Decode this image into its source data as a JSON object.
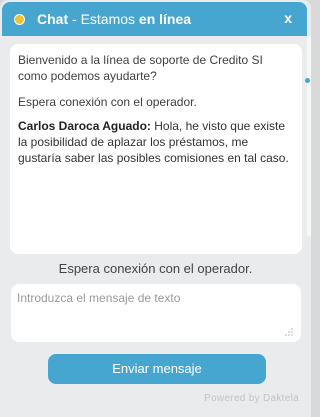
{
  "header": {
    "title_chat": "Chat",
    "title_separator": " - Estamos ",
    "title_status": "en línea",
    "close_label": "x",
    "colors": {
      "header_bg": "#46a6cf",
      "status_dot": "#f2c230"
    },
    "status_icon": "status-dot-icon"
  },
  "messages": {
    "welcome": "Bienvenido a la línea de soporte de Credito SI como podemos ayudarte?",
    "waiting": "Espera conexión con el operador.",
    "user_message": {
      "author": "Carlos Daroca Aguado:",
      "text": " Hola, he visto que existe la posibilidad de aplazar los préstamos, me gustaría saber las posibles comisiones en tal caso."
    }
  },
  "status_line": "Espera conexión con el operador.",
  "input": {
    "placeholder": "Introduzca el mensaje de texto",
    "value": ""
  },
  "send_button": {
    "label": "Enviar mensaje",
    "color": "#46a6cf"
  },
  "footer": {
    "powered_by": "Powered by Daktela"
  }
}
